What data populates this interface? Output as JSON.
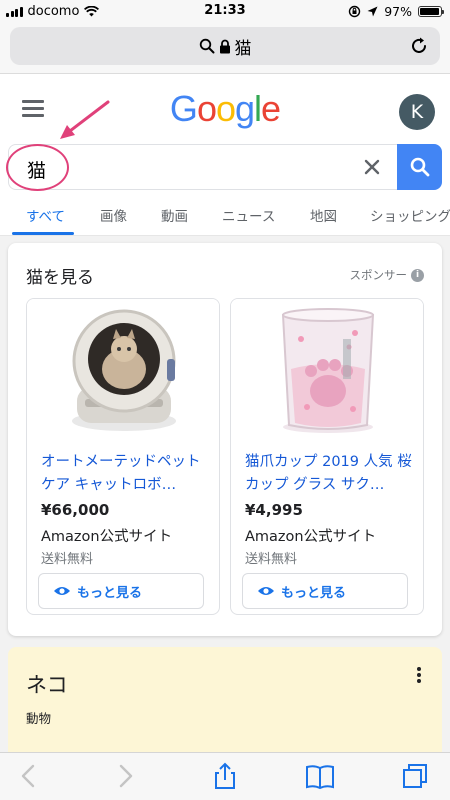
{
  "status_bar": {
    "carrier": "docomo",
    "time": "21:33",
    "battery": "97%",
    "battery_level": 0.97
  },
  "url_bar": {
    "text": "猫",
    "icons": [
      "search-icon",
      "lock-icon",
      "reload-icon"
    ]
  },
  "header": {
    "logo_letters": [
      {
        "ch": "G",
        "color": "#4285F4"
      },
      {
        "ch": "o",
        "color": "#EA4335"
      },
      {
        "ch": "o",
        "color": "#FBBC05"
      },
      {
        "ch": "g",
        "color": "#4285F4"
      },
      {
        "ch": "l",
        "color": "#34A853"
      },
      {
        "ch": "e",
        "color": "#EA4335"
      }
    ],
    "avatar_letter": "K"
  },
  "search": {
    "query": "猫",
    "accent_color": "#4285f4"
  },
  "tabs": [
    {
      "label": "すべて",
      "active": true
    },
    {
      "label": "画像",
      "active": false
    },
    {
      "label": "動画",
      "active": false
    },
    {
      "label": "ニュース",
      "active": false
    },
    {
      "label": "地図",
      "active": false
    },
    {
      "label": "ショッピング",
      "active": false
    }
  ],
  "shopping": {
    "title": "猫を見る",
    "sponsor_label": "スポンサー",
    "products": [
      {
        "name": "オートメーテッドペットケア キャットロボ…",
        "price": "¥66,000",
        "seller": "Amazon公式サイト",
        "shipping": "送料無料",
        "more_label": "もっと見る"
      },
      {
        "name": "猫爪カップ 2019 人気 桜カップ グラス サク…",
        "price": "¥4,995",
        "seller": "Amazon公式サイト",
        "shipping": "送料無料",
        "more_label": "もっと見る"
      }
    ]
  },
  "knowledge": {
    "title": "ネコ",
    "subtitle": "動物"
  },
  "annotation": {
    "color": "#e0417a"
  }
}
